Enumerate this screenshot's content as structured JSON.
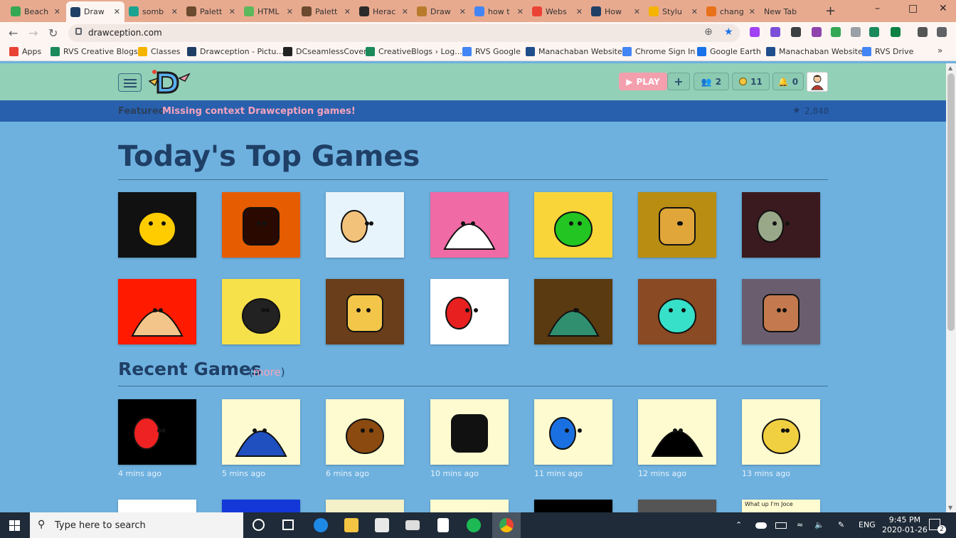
{
  "browser": {
    "tabs": [
      {
        "label": "Beach",
        "color": "#34a853"
      },
      {
        "label": "Draw",
        "color": "#1f3f66"
      },
      {
        "label": "somb",
        "color": "#1aa391"
      },
      {
        "label": "Palett",
        "color": "#6b4a2f"
      },
      {
        "label": "HTML",
        "color": "#5cb85c"
      },
      {
        "label": "Palett",
        "color": "#6b4a2f"
      },
      {
        "label": "Herac",
        "color": "#2a2a2a"
      },
      {
        "label": "Draw",
        "color": "#b87b2b"
      },
      {
        "label": "how t",
        "color": "#4285f4"
      },
      {
        "label": "Webs",
        "color": "#ea4335"
      },
      {
        "label": "How",
        "color": "#1f3f66"
      },
      {
        "label": "Stylu",
        "color": "#f4b400"
      },
      {
        "label": "chang",
        "color": "#e8711a"
      },
      {
        "label": "New Tab",
        "color": ""
      }
    ],
    "url": "drawception.com",
    "bookmarks": [
      {
        "label": "Apps",
        "color": "#e94235"
      },
      {
        "label": "RVS Creative Blogs",
        "color": "#1a8a5a"
      },
      {
        "label": "Classes",
        "color": "#f4b400"
      },
      {
        "label": "Drawception - Pictu...",
        "color": "#1f3f66"
      },
      {
        "label": "DCseamlessCover",
        "color": "#222222"
      },
      {
        "label": "CreativeBlogs › Log...",
        "color": "#1a8a5a"
      },
      {
        "label": "RVS Google",
        "color": "#4285f4"
      },
      {
        "label": "Manachaban Website",
        "color": "#1f4e8c"
      },
      {
        "label": "Chrome Sign In",
        "color": "#4285f4"
      },
      {
        "label": "Google Earth",
        "color": "#1a73e8"
      },
      {
        "label": "Manachaban Website",
        "color": "#1f4e8c"
      },
      {
        "label": "RVS Drive",
        "color": "#4285f4"
      }
    ]
  },
  "site": {
    "play_label": "PLAY",
    "add_label": "+",
    "friends_count": "2",
    "coins_count": "11",
    "notifications_count": "0",
    "featured_label": "Featured",
    "featured_link": "Missing context Drawception games!",
    "featured_count": "2,848"
  },
  "main": {
    "title": "Today's Top Games",
    "recent_title": "Recent Games",
    "more_open": "(",
    "more_label": "more",
    "more_close": ")",
    "top_games": [
      {
        "name": "top-game-1",
        "bg": "#111111",
        "accent": "#ffcc00"
      },
      {
        "name": "top-game-2",
        "bg": "#e65c00",
        "accent": "#2a0a00"
      },
      {
        "name": "top-game-3",
        "bg": "#e8f4fb",
        "accent": "#f2c27a"
      },
      {
        "name": "top-game-4",
        "bg": "#f06aa6",
        "accent": "#ffffff"
      },
      {
        "name": "top-game-5",
        "bg": "#f9d53a",
        "accent": "#22c522"
      },
      {
        "name": "top-game-6",
        "bg": "#b88d12",
        "accent": "#e0a63a"
      },
      {
        "name": "top-game-7",
        "bg": "#3a1a1e",
        "accent": "#9aa88a"
      },
      {
        "name": "top-game-8",
        "bg": "#ff1a00",
        "accent": "#f4c58a"
      },
      {
        "name": "top-game-9",
        "bg": "#f6e14a",
        "accent": "#222222"
      },
      {
        "name": "top-game-10",
        "bg": "#6a3e1a",
        "accent": "#f3c64a"
      },
      {
        "name": "top-game-11",
        "bg": "#ffffff",
        "accent": "#e82020"
      },
      {
        "name": "top-game-12",
        "bg": "#5a3a10",
        "accent": "#2f8f6f"
      },
      {
        "name": "top-game-13",
        "bg": "#8a4a24",
        "accent": "#37e0c8"
      },
      {
        "name": "top-game-14",
        "bg": "#6a5e6e",
        "accent": "#c47a4e"
      }
    ],
    "recent_games": [
      {
        "name": "recent-game-1",
        "bg": "#000000",
        "accent": "#ee2222",
        "time": "4 mins ago"
      },
      {
        "name": "recent-game-2",
        "bg": "#fffbd0",
        "accent": "#2050c0",
        "time": "5 mins ago"
      },
      {
        "name": "recent-game-3",
        "bg": "#fffbd0",
        "accent": "#8a4a10",
        "time": "6 mins ago"
      },
      {
        "name": "recent-game-4",
        "bg": "#fffbd0",
        "accent": "#111111",
        "time": "10 mins ago"
      },
      {
        "name": "recent-game-5",
        "bg": "#fffbd0",
        "accent": "#1a70e0",
        "time": "11 mins ago"
      },
      {
        "name": "recent-game-6",
        "bg": "#fffbd0",
        "accent": "#000000",
        "time": "12 mins ago"
      },
      {
        "name": "recent-game-7",
        "bg": "#fffbd0",
        "accent": "#f0d040",
        "time": "13 mins ago"
      }
    ],
    "partial_games": [
      {
        "name": "partial-game-1",
        "bg": "#ffffff"
      },
      {
        "name": "partial-game-2",
        "bg": "#1438d8"
      },
      {
        "name": "partial-game-3",
        "bg": "#f4f0c8"
      },
      {
        "name": "partial-game-4",
        "bg": "#fffbd0"
      },
      {
        "name": "partial-game-5",
        "bg": "#000000"
      },
      {
        "name": "partial-game-6",
        "bg": "#555555"
      },
      {
        "name": "partial-game-7",
        "bg": "#fffbd0",
        "text": "What up I'm Joce"
      }
    ]
  },
  "taskbar": {
    "search_placeholder": "Type here to search",
    "lang": "ENG",
    "time": "9:45 PM",
    "date": "2020-01-26",
    "notif_count": "2"
  }
}
